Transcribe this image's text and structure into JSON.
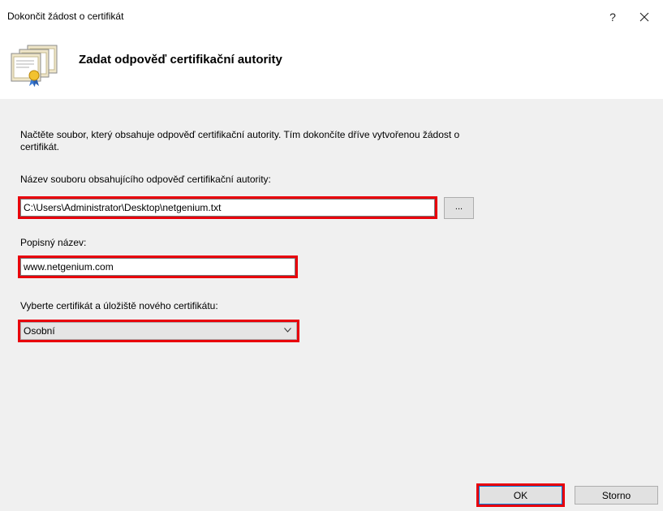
{
  "window": {
    "title": "Dokončit žádost o certifikát",
    "help_label": "?",
    "close_icon": "close-icon"
  },
  "header": {
    "icon": "certificate-icon",
    "title": "Zadat odpověď certifikační autority"
  },
  "main": {
    "intro_line1": "Načtěte soubor, který obsahuje odpověď certifikační autority. Tím dokončíte dříve vytvořenou žádost o",
    "intro_line2": "certifikát.",
    "file_label": "Název souboru obsahujícího odpověď certifikační autority:",
    "file_value": "C:\\Users\\Administrator\\Desktop\\netgenium.txt",
    "browse_label": "...",
    "friendly_label": "Popisný název:",
    "friendly_value": "www.netgenium.com",
    "store_label": "Vyberte certifikát a úložiště nového certifikátu:",
    "store_value": "Osobní"
  },
  "buttons": {
    "ok": "OK",
    "cancel": "Storno"
  },
  "colors": {
    "highlight": "#e8000b",
    "content_bg": "#f0f0f0",
    "ok_border": "#0078d7"
  }
}
